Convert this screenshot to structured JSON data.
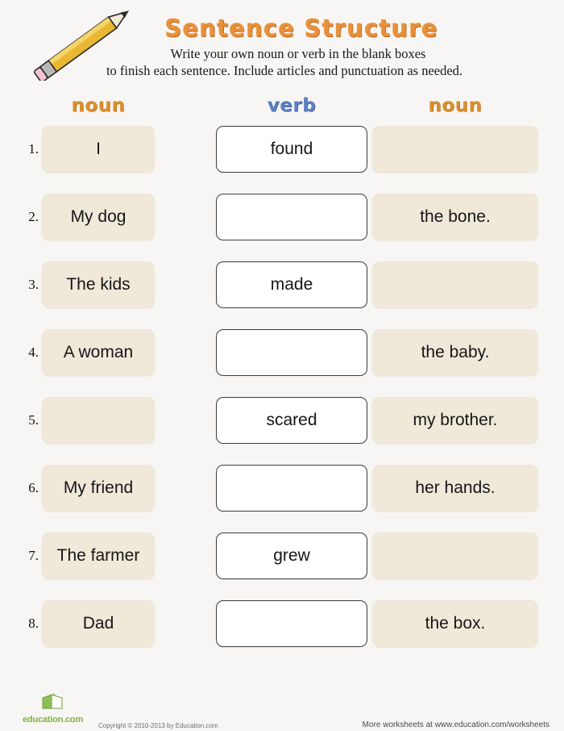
{
  "header": {
    "title": "Sentence Structure",
    "instruction_line1": "Write your own noun or verb in the blank boxes",
    "instruction_line2": "to finish each sentence. Include articles and punctuation as needed.",
    "pencil_icon": "pencil-icon"
  },
  "colors": {
    "title": "#e8903a",
    "noun_header": "#d98f2e",
    "verb_header": "#5d7fc2",
    "noun_box_fill": "#f0e9da",
    "verb_box_fill": "#ffffff",
    "verb_box_border": "#3b3b3b",
    "page_background": "#f8f6f4",
    "logo_green": "#7cb342"
  },
  "columns": [
    {
      "label": "noun",
      "type": "noun"
    },
    {
      "label": "verb",
      "type": "verb"
    },
    {
      "label": "noun",
      "type": "noun"
    }
  ],
  "rows": [
    {
      "number": "1.",
      "noun1": "I",
      "verb": "found",
      "noun2": ""
    },
    {
      "number": "2.",
      "noun1": "My dog",
      "verb": "",
      "noun2": "the bone."
    },
    {
      "number": "3.",
      "noun1": "The kids",
      "verb": "made",
      "noun2": ""
    },
    {
      "number": "4.",
      "noun1": "A woman",
      "verb": "",
      "noun2": "the baby."
    },
    {
      "number": "5.",
      "noun1": "",
      "verb": "scared",
      "noun2": "my brother."
    },
    {
      "number": "6.",
      "noun1": "My friend",
      "verb": "",
      "noun2": "her hands."
    },
    {
      "number": "7.",
      "noun1": "The farmer",
      "verb": "grew",
      "noun2": ""
    },
    {
      "number": "8.",
      "noun1": "Dad",
      "verb": "",
      "noun2": "the box."
    }
  ],
  "footer": {
    "logo_text": "education.com",
    "logo_icon": "open-book-icon",
    "copyright": "Copyright © 2010-2013 by Education.com",
    "more_worksheets": "More worksheets at www.education.com/worksheets"
  }
}
